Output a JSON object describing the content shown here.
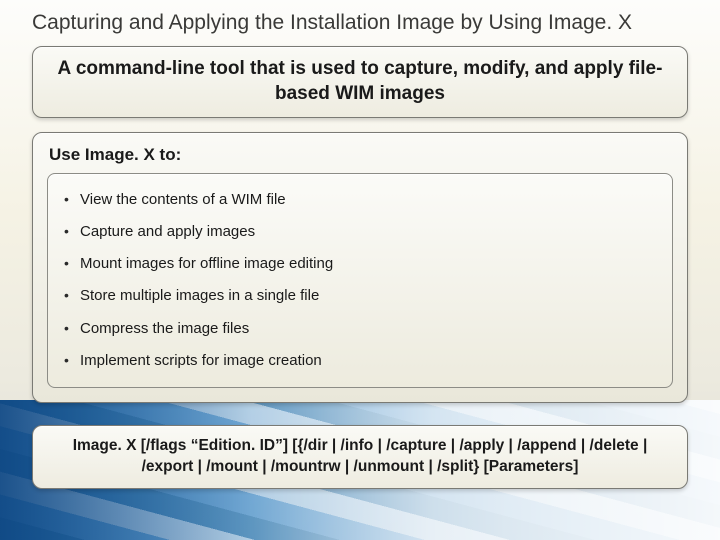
{
  "title": "Capturing and Applying the Installation Image by Using Image. X",
  "intro": "A command-line tool that is used to capture, modify, and apply file-based WIM images",
  "use_heading": "Use Image. X to:",
  "bullets": [
    "View the contents of a WIM file",
    "Capture and apply images",
    "Mount images for offline image editing",
    "Store multiple images in a single file",
    "Compress the image files",
    "Implement scripts for image creation"
  ],
  "syntax": "Image. X [/flags “Edition. ID”] [{/dir | /info | /capture | /apply | /append | /delete | /export | /mount | /mountrw | /unmount | /split} [Parameters]"
}
